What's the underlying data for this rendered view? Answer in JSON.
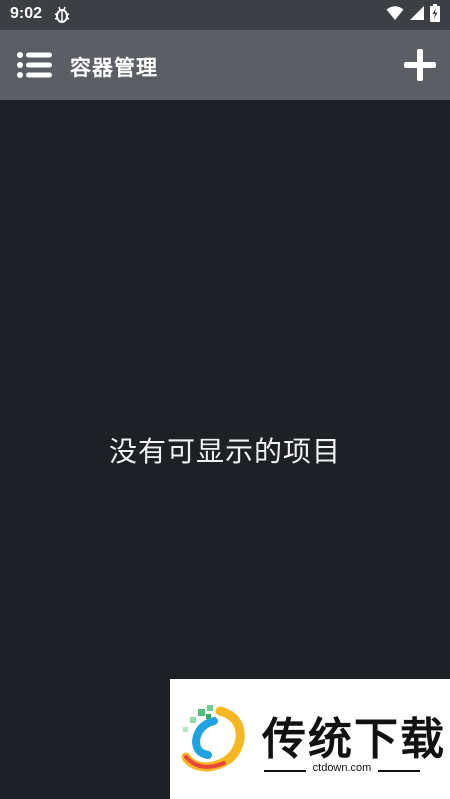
{
  "status_bar": {
    "time": "9:02"
  },
  "app_bar": {
    "title": "容器管理"
  },
  "content": {
    "empty_message": "没有可显示的项目"
  },
  "watermark": {
    "title": "传统下载",
    "url": "ctdown.com"
  },
  "colors": {
    "status_bar": "#3c3f44",
    "app_bar": "#5b5f65",
    "background": "#1d2024",
    "text": "#ffffff"
  }
}
